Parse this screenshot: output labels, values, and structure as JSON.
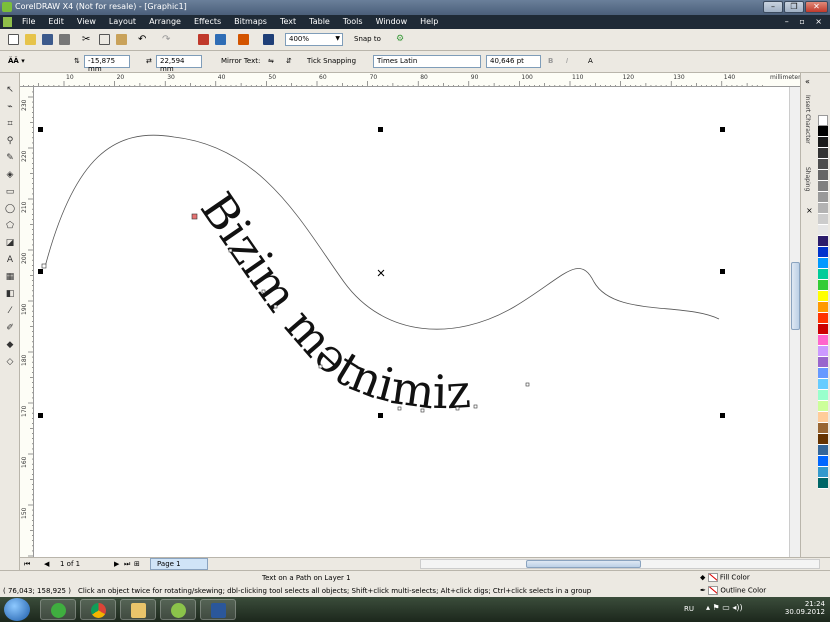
{
  "window": {
    "title": "CorelDRAW X4 (Not for resale) - [Graphic1]"
  },
  "menu": {
    "items": [
      "File",
      "Edit",
      "View",
      "Layout",
      "Arrange",
      "Effects",
      "Bitmaps",
      "Text",
      "Table",
      "Tools",
      "Window",
      "Help"
    ]
  },
  "toolbar": {
    "zoom": "400%",
    "snap_to": "Snap to"
  },
  "propbar": {
    "distance_h": "-15,875 mm",
    "distance_v": "22,594 mm",
    "mirror_text": "Mirror Text:",
    "tick_snapping": "Tick Snapping",
    "font_name": "Times Latin",
    "font_size": "40,646 pt"
  },
  "ruler": {
    "units": "millimeters",
    "h_ticks": [
      "10",
      "20",
      "30",
      "40",
      "50",
      "60",
      "70",
      "80",
      "90",
      "100",
      "110",
      "120",
      "130",
      "140"
    ],
    "v_ticks": [
      "230",
      "220",
      "210",
      "200",
      "190",
      "180",
      "170",
      "160",
      "150"
    ]
  },
  "canvas": {
    "path_text": "Bizim mətnimiz"
  },
  "docker": {
    "tabs": [
      "Insert Character",
      "Shaping"
    ]
  },
  "palette": {
    "colors": [
      "#ffffff",
      "#000000",
      "#1a1a1a",
      "#333333",
      "#4d4d4d",
      "#666666",
      "#808080",
      "#999999",
      "#b3b3b3",
      "#cccccc",
      "#e6e6e6",
      "#2b1b6b",
      "#0033cc",
      "#0099ff",
      "#00cc99",
      "#33cc33",
      "#ffff00",
      "#ff9900",
      "#ff3300",
      "#cc0000",
      "#ff66cc",
      "#cc99ff",
      "#9966cc",
      "#6699ff",
      "#66ccff",
      "#99ffcc",
      "#ccff99",
      "#ffcc99",
      "#996633",
      "#663300",
      "#336699",
      "#0066ff",
      "#3399cc",
      "#006666"
    ]
  },
  "pagebar": {
    "page_count": "1 of 1",
    "page_tab": "Page 1"
  },
  "status": {
    "object_info": "Text on a Path on Layer 1",
    "coords": "( 76,043; 158,925 )",
    "hint": "Click an object twice for rotating/skewing; dbl-clicking tool selects all objects; Shift+click multi-selects; Alt+click digs; Ctrl+click selects in a group",
    "fill_label": "Fill Color",
    "outline_label": "Outline Color"
  },
  "taskbar": {
    "lang": "RU",
    "time": "21:24",
    "date": "30.09.2012"
  }
}
